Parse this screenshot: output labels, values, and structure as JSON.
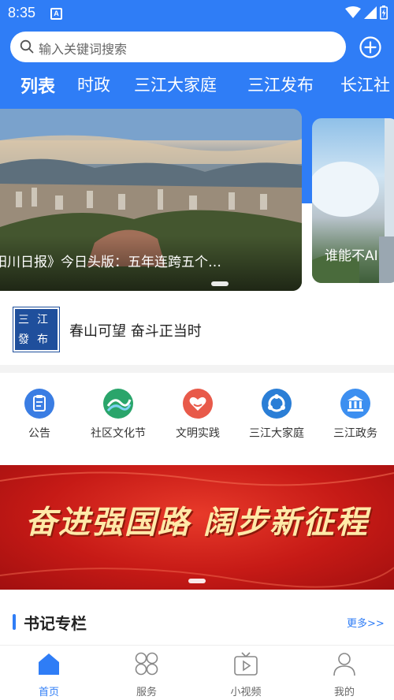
{
  "status_bar": {
    "time": "8:35",
    "notification_letter": "A"
  },
  "search": {
    "placeholder": "输入关键词搜索"
  },
  "tabs": [
    {
      "label": "列表",
      "active": true
    },
    {
      "label": "时政",
      "active": false
    },
    {
      "label": "三江大家庭",
      "active": false
    },
    {
      "label": "三江发布",
      "active": false
    },
    {
      "label": "长江社",
      "active": false
    }
  ],
  "carousel": {
    "slides": [
      {
        "caption": "阳川日报》今日头版：五年连跨五个…"
      },
      {
        "caption": "谁能不AI"
      }
    ],
    "current_index": 1
  },
  "publisher": {
    "logo_chars": [
      "三",
      "江",
      "發",
      "布"
    ],
    "title": "春山可望 奋斗正当时"
  },
  "shortcuts": [
    {
      "label": "公告",
      "icon": "notice-clipboard-icon",
      "color": "#3a7de3"
    },
    {
      "label": "社区文化节",
      "icon": "river-wave-icon",
      "color": "#2aa56b"
    },
    {
      "label": "文明实践",
      "icon": "heart-hands-icon",
      "color": "#e85a4a"
    },
    {
      "label": "三江大家庭",
      "icon": "orbit-circle-icon",
      "color": "#2a7ed6"
    },
    {
      "label": "三江政务",
      "icon": "government-building-icon",
      "color": "#3d8ff0"
    }
  ],
  "banner": {
    "slogan": "奋进强国路  阔步新征程"
  },
  "section": {
    "title": "书记专栏",
    "more_label": "更多>>"
  },
  "bottom_nav": [
    {
      "label": "首页",
      "icon": "home-icon",
      "active": true
    },
    {
      "label": "服务",
      "icon": "services-grid-icon",
      "active": false
    },
    {
      "label": "小视频",
      "icon": "video-play-icon",
      "active": false
    },
    {
      "label": "我的",
      "icon": "profile-icon",
      "active": false
    }
  ],
  "colors": {
    "brand": "#2f7df6",
    "banner_red": "#c61a16",
    "slogan_gold": "#ffe9a8"
  }
}
